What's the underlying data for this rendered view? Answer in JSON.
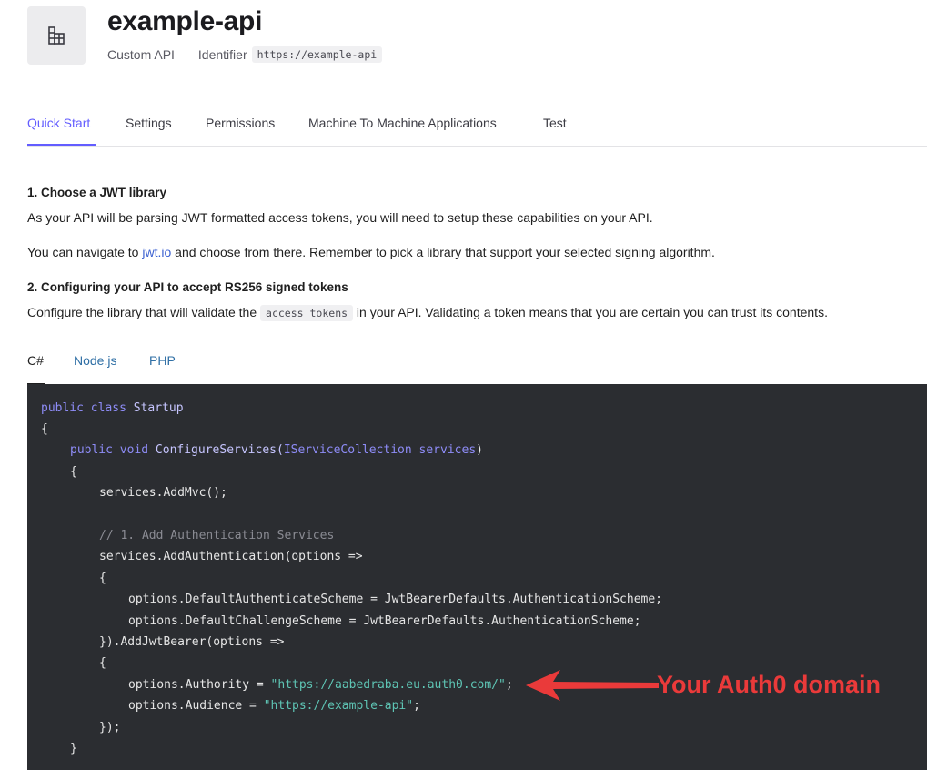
{
  "api": {
    "name": "example-api",
    "type": "Custom API",
    "identifier_label": "Identifier",
    "identifier_value": "https://example-api"
  },
  "tabs": [
    {
      "label": "Quick Start",
      "active": true
    },
    {
      "label": "Settings"
    },
    {
      "label": "Permissions"
    },
    {
      "label": "Machine To Machine Applications"
    },
    {
      "label": "Test"
    }
  ],
  "quickstart": {
    "step1_heading": "1. Choose a JWT library",
    "step1_text": "As your API will be parsing JWT formatted access tokens, you will need to setup these capabilities on your API.",
    "nav_before": "You can navigate to ",
    "nav_link": "jwt.io",
    "nav_after": " and choose from there. Remember to pick a library that support your selected signing algorithm.",
    "step2_heading": "2. Configuring your API to accept RS256 signed tokens",
    "step2_before": "Configure the library that will validate the ",
    "step2_code": "access tokens",
    "step2_after": " in your API. Validating a token means that you are certain you can trust its contents."
  },
  "languages": [
    "C#",
    "Node.js",
    "PHP"
  ],
  "code": {
    "l1_kw": "public class ",
    "l1_cls": "Startup",
    "l2": "{",
    "l3_kw1": "public void ",
    "l3_fn": "ConfigureServices(",
    "l3_type": "IServiceCollection",
    "l3_param": " services",
    "l3_end": ")",
    "l4": "{",
    "l5": "services.AddMvc();",
    "l6_comment": "// 1. Add Authentication Services",
    "l7": "services.AddAuthentication(options =>",
    "l8": "{",
    "l9": "options.DefaultAuthenticateScheme = JwtBearerDefaults.AuthenticationScheme;",
    "l10": "options.DefaultChallengeScheme = JwtBearerDefaults.AuthenticationScheme;",
    "l11": "}).AddJwtBearer(options =>",
    "l12": "{",
    "l13_a": "options.Authority = ",
    "l13_str": "\"https://aabedraba.eu.auth0.com/\"",
    "l13_end": ";",
    "l14_a": "options.Audience = ",
    "l14_str": "\"https://example-api\"",
    "l14_end": ";",
    "l15": "});",
    "l16": "}"
  },
  "annotation": "Your Auth0 domain",
  "colors": {
    "accent": "#635dff",
    "annotation": "#ea3a3a",
    "code_bg": "#2b2d31"
  }
}
